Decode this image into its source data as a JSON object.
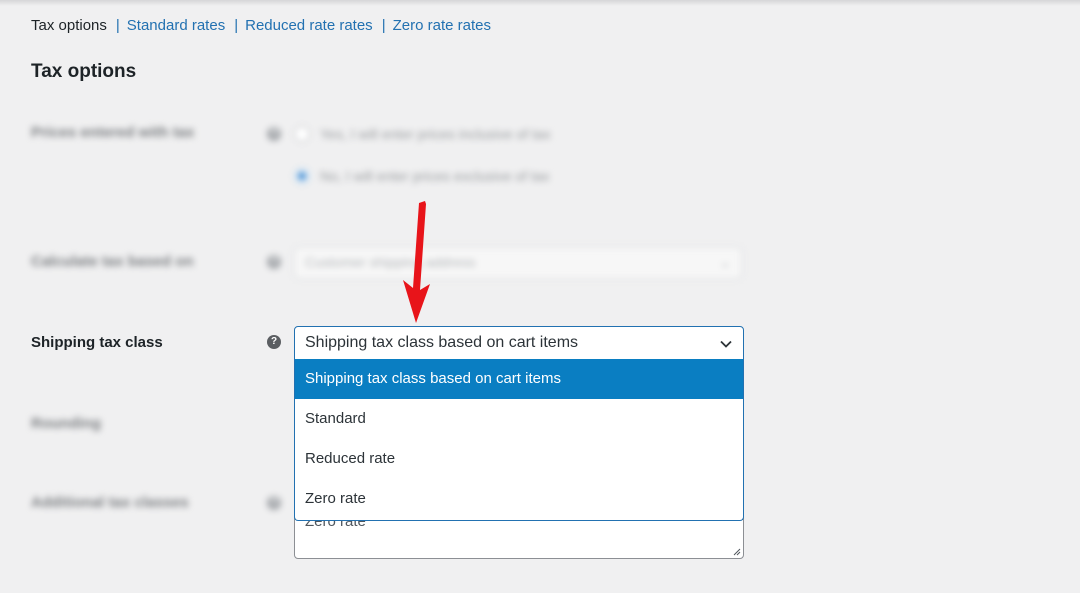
{
  "subnav": {
    "current": "Tax options",
    "links": [
      "Standard rates",
      "Reduced rate rates",
      "Zero rate rates"
    ],
    "separator": "|"
  },
  "section": {
    "title": "Tax options"
  },
  "fields": {
    "prices_entered": {
      "label": "Prices entered with tax",
      "options": [
        "Yes, I will enter prices inclusive of tax",
        "No, I will enter prices exclusive of tax"
      ]
    },
    "calculate_based_on": {
      "label": "Calculate tax based on",
      "value": "Customer shipping address"
    },
    "shipping_tax_class": {
      "label": "Shipping tax class",
      "value": "Shipping tax class based on cart items",
      "options": [
        "Shipping tax class based on cart items",
        "Standard",
        "Reduced rate",
        "Zero rate"
      ],
      "selected_index": 0
    },
    "rounding": {
      "label": "Rounding"
    },
    "additional_classes": {
      "label": "Additional tax classes",
      "textarea_visible": "Zero rate"
    }
  },
  "icons": {
    "help": "question-mark-icon",
    "chevron": "chevron-down-icon",
    "arrow": "red-arrow-down"
  },
  "colors": {
    "link": "#2271b1",
    "highlight": "#0a7ec2",
    "arrow": "#e8141a",
    "background": "#f0f0f1"
  }
}
